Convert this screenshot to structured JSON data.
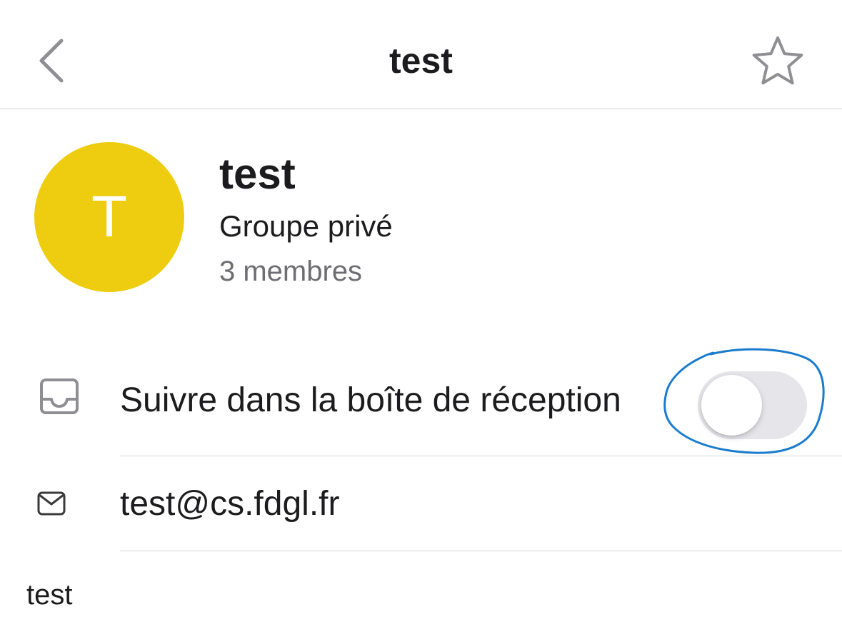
{
  "header": {
    "title": "test",
    "back_icon": "chevron-left-icon",
    "favorite_icon": "star-outline-icon"
  },
  "group": {
    "avatar_initial": "T",
    "avatar_color": "#eecd10",
    "name": "test",
    "type": "Groupe privé",
    "members": "3 membres"
  },
  "settings": {
    "follow_inbox": {
      "icon": "inbox-tray-icon",
      "label": "Suivre dans la boîte de réception",
      "enabled": false
    },
    "email": {
      "icon": "envelope-icon",
      "value": "test@cs.fdgl.fr"
    }
  },
  "description": "test",
  "colors": {
    "annotation": "#1b7ccd",
    "toggle_off": "#e5e5ea",
    "secondary_text": "#6d6d72"
  }
}
